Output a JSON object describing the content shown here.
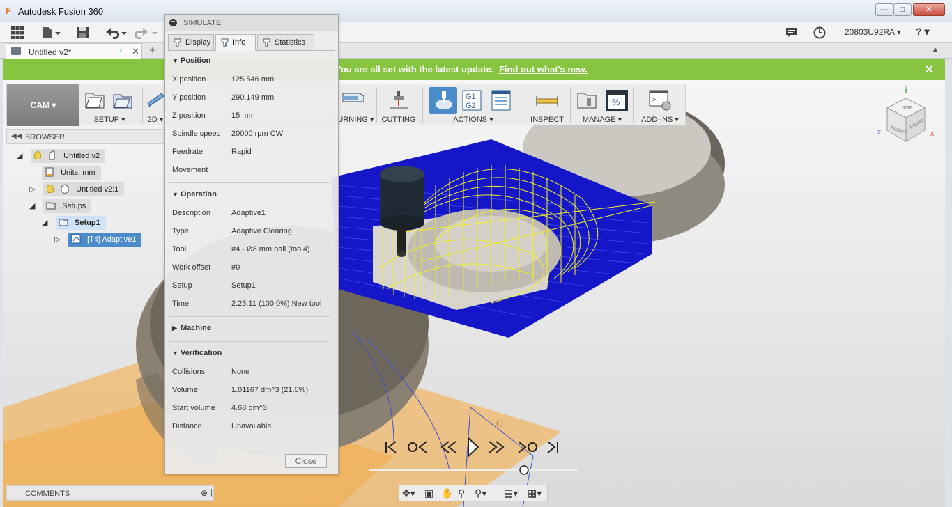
{
  "window": {
    "title": "Autodesk Fusion 360",
    "minimize": "—",
    "maximize": "□",
    "close": "✕"
  },
  "quick_access": {
    "user": "20803U92RA ▾",
    "help": "? ▾"
  },
  "doc_tab": {
    "name": "Untitled v2*"
  },
  "banner": {
    "message": "You are all set with the latest update.",
    "link": "Find out what's new.",
    "close": "✕"
  },
  "ribbon": {
    "workspace": "CAM ▾",
    "groups": [
      {
        "label": "SETUP ▾"
      },
      {
        "label": "2D ▾"
      },
      {
        "label": "TURNING ▾"
      },
      {
        "label": "CUTTING"
      },
      {
        "label": "ACTIONS ▾"
      },
      {
        "label": "INSPECT"
      },
      {
        "label": "MANAGE ▾"
      },
      {
        "label": "ADD-INS ▾"
      }
    ]
  },
  "browser": {
    "header": "BROWSER",
    "nodes": [
      {
        "label": "Untitled v2"
      },
      {
        "label": "Units: mm"
      },
      {
        "label": "Untitled v2:1"
      },
      {
        "label": "Setups"
      },
      {
        "label": "Setup1"
      },
      {
        "label": "[T4] Adaptive1"
      }
    ]
  },
  "comments": {
    "label": "COMMENTS"
  },
  "simulate": {
    "title": "SIMULATE",
    "tabs": [
      "Display",
      "Info",
      "Statistics"
    ],
    "active_tab": "Info",
    "sections": {
      "position": {
        "title": "Position",
        "rows": [
          {
            "label": "X position",
            "value": "125.546 mm"
          },
          {
            "label": "Y position",
            "value": "290.149 mm"
          },
          {
            "label": "Z position",
            "value": "15 mm"
          },
          {
            "label": "Spindle speed",
            "value": "20000 rpm CW"
          },
          {
            "label": "Feedrate",
            "value": "Rapid"
          },
          {
            "label": "Movement",
            "value": ""
          }
        ]
      },
      "operation": {
        "title": "Operation",
        "rows": [
          {
            "label": "Description",
            "value": "Adaptive1"
          },
          {
            "label": "Type",
            "value": "Adaptive Clearing"
          },
          {
            "label": "Tool",
            "value": "#4 - Ø8 mm ball (tool4)"
          },
          {
            "label": "Work offset",
            "value": "#0"
          },
          {
            "label": "Setup",
            "value": "Setup1"
          },
          {
            "label": "Time",
            "value": "2:25:11 (100.0%) New tool"
          }
        ]
      },
      "machine": {
        "title": "Machine"
      },
      "verification": {
        "title": "Verification",
        "rows": [
          {
            "label": "Collisions",
            "value": "None"
          },
          {
            "label": "Volume",
            "value": "1.01167 dm^3 (21.6%)"
          },
          {
            "label": "Start volume",
            "value": "4.68 dm^3"
          },
          {
            "label": "Distance",
            "value": "Unavailable"
          }
        ]
      }
    },
    "close_button": "Close"
  },
  "viewcube": {
    "top": "TOP",
    "front": "FRONT",
    "right": "RIGHT"
  },
  "colors": {
    "banner": "#87c540",
    "toolpath": "#f5f21a",
    "stock_lines": "#1416c8",
    "selection": "#4b8cc8"
  },
  "playback": {
    "progress": 1.0
  }
}
